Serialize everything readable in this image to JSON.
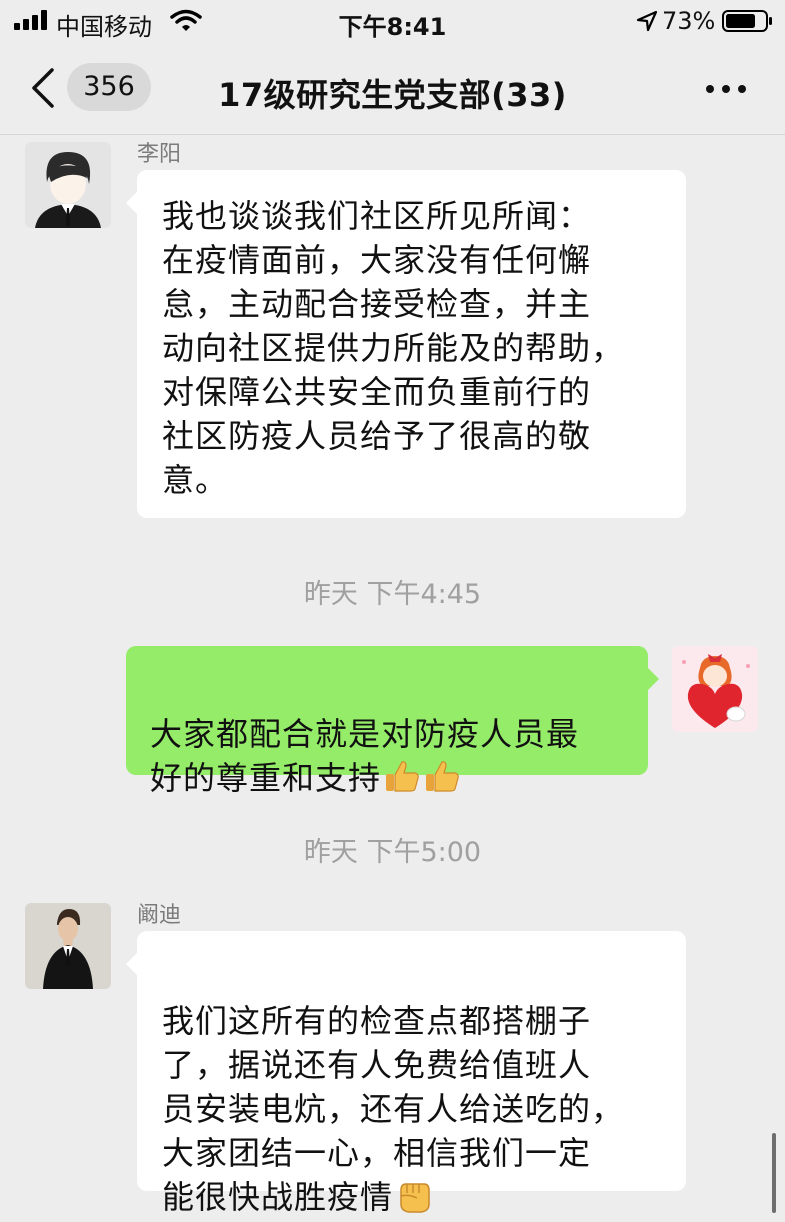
{
  "status_bar": {
    "carrier": "中国移动",
    "time": "下午8:41",
    "battery_pct": "73%",
    "icons": [
      "signal-icon",
      "wifi-icon",
      "location-arrow-icon",
      "battery-icon"
    ]
  },
  "nav": {
    "unread_count": "356",
    "title": "17级研究生党支部(33)",
    "icons": [
      "back-chevron-icon",
      "more-icon"
    ]
  },
  "messages": [
    {
      "sender": "李阳",
      "direction": "incoming",
      "text": "我也谈谈我们社区所见所闻：\n在疫情面前，大家没有任何懈\n怠，主动配合接受检查，并主\n动向社区提供力所能及的帮助，\n对保障公共安全而负重前行的\n社区防疫人员给予了很高的敬\n意。"
    },
    {
      "direction": "outgoing",
      "text": "大家都配合就是对防疫人员最\n好的尊重和支持",
      "emoji": [
        "thumbs-up-icon",
        "thumbs-up-icon"
      ]
    },
    {
      "sender": "阚迪",
      "direction": "incoming",
      "text": "我们这所有的检查点都搭棚子\n了，据说还有人免费给值班人\n员安装电炕，还有人给送吃的，\n大家团结一心，相信我们一定\n能很快战胜疫情",
      "emoji": [
        "raised-fist-icon"
      ]
    }
  ],
  "timestamps": [
    "昨天 下午4:45",
    "昨天 下午5:00"
  ],
  "colors": {
    "chat_background": "#ededed",
    "incoming_bubble": "#ffffff",
    "outgoing_bubble": "#95ec69"
  }
}
